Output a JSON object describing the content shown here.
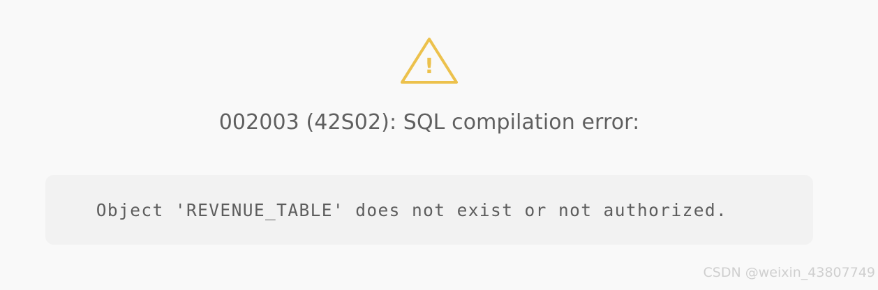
{
  "error": {
    "icon": "warning-triangle-icon",
    "icon_color": "#ecc14c",
    "icon_glyph": "!",
    "title": "002003 (42S02): SQL compilation error:",
    "detail": "Object 'REVENUE_TABLE' does not exist or not authorized."
  },
  "watermark": "CSDN @weixin_43807749",
  "colors": {
    "background": "#f9f9f9",
    "detail_box": "#f2f2f2",
    "text": "#5f5f5f"
  }
}
